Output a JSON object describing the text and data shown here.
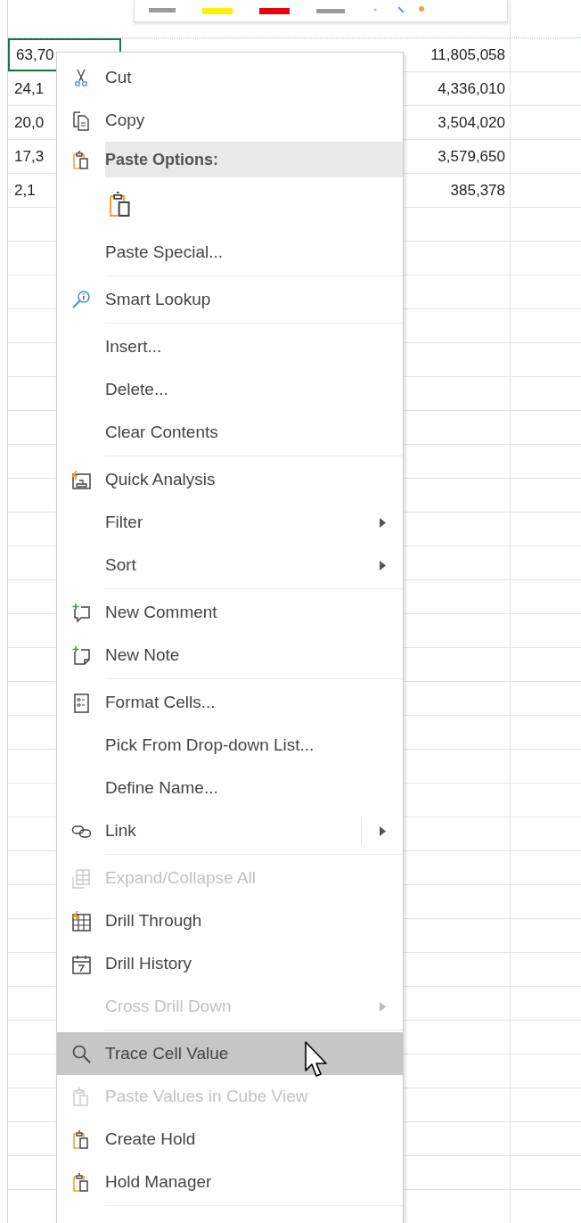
{
  "sheet": {
    "rows": [
      {
        "cells": [
          {
            "text": "63,70",
            "selected": true
          },
          {
            "text": "11,805,058",
            "selected": false
          }
        ]
      },
      {
        "cells": [
          {
            "text": "24,1",
            "selected": false
          },
          {
            "text": "4,336,010",
            "selected": false
          }
        ]
      },
      {
        "cells": [
          {
            "text": "20,0",
            "selected": false
          },
          {
            "text": "3,504,020",
            "selected": false
          }
        ]
      },
      {
        "cells": [
          {
            "text": "17,3",
            "selected": false
          },
          {
            "text": "3,579,650",
            "selected": false
          }
        ]
      },
      {
        "cells": [
          {
            "text": "2,1",
            "selected": false
          },
          {
            "text": "385,378",
            "selected": false
          }
        ]
      }
    ]
  },
  "context_menu": {
    "items": [
      {
        "kind": "command",
        "label": "Cut",
        "disabled": false,
        "selected": false,
        "submenu": false,
        "separator_after": false
      },
      {
        "kind": "command",
        "label": "Copy",
        "disabled": false,
        "selected": false,
        "submenu": false,
        "separator_after": false
      },
      {
        "kind": "header",
        "label": "Paste Options:"
      },
      {
        "kind": "paste-icons"
      },
      {
        "kind": "command",
        "label": "Paste Special...",
        "disabled": false,
        "selected": false,
        "submenu": false,
        "separator_after": true
      },
      {
        "kind": "command",
        "label": "Smart Lookup",
        "disabled": false,
        "selected": false,
        "submenu": false,
        "separator_after": true
      },
      {
        "kind": "command",
        "label": "Insert...",
        "disabled": false,
        "selected": false,
        "submenu": false,
        "separator_after": false
      },
      {
        "kind": "command",
        "label": "Delete...",
        "disabled": false,
        "selected": false,
        "submenu": false,
        "separator_after": false
      },
      {
        "kind": "command",
        "label": "Clear Contents",
        "disabled": false,
        "selected": false,
        "submenu": false,
        "separator_after": true
      },
      {
        "kind": "command",
        "label": "Quick Analysis",
        "disabled": false,
        "selected": false,
        "submenu": false,
        "separator_after": false
      },
      {
        "kind": "command",
        "label": "Filter",
        "disabled": false,
        "selected": false,
        "submenu": true,
        "separator_after": false
      },
      {
        "kind": "command",
        "label": "Sort",
        "disabled": false,
        "selected": false,
        "submenu": true,
        "separator_after": true
      },
      {
        "kind": "command",
        "label": "New Comment",
        "disabled": false,
        "selected": false,
        "submenu": false,
        "separator_after": false
      },
      {
        "kind": "command",
        "label": "New Note",
        "disabled": false,
        "selected": false,
        "submenu": false,
        "separator_after": true
      },
      {
        "kind": "command",
        "label": "Format Cells...",
        "disabled": false,
        "selected": false,
        "submenu": false,
        "separator_after": false
      },
      {
        "kind": "command",
        "label": "Pick From Drop-down List...",
        "disabled": false,
        "selected": false,
        "submenu": false,
        "separator_after": false
      },
      {
        "kind": "command",
        "label": "Define Name...",
        "disabled": false,
        "selected": false,
        "submenu": false,
        "separator_after": false
      },
      {
        "kind": "split",
        "label": "Link",
        "disabled": false,
        "selected": false,
        "submenu": true,
        "separator_after": true
      },
      {
        "kind": "command",
        "label": "Expand/Collapse All",
        "disabled": true,
        "selected": false,
        "submenu": false,
        "separator_after": false
      },
      {
        "kind": "command",
        "label": "Drill Through",
        "disabled": false,
        "selected": false,
        "submenu": false,
        "separator_after": false
      },
      {
        "kind": "command",
        "label": "Drill History",
        "disabled": false,
        "selected": false,
        "submenu": false,
        "separator_after": false
      },
      {
        "kind": "command",
        "label": "Cross Drill Down",
        "disabled": true,
        "selected": false,
        "submenu": true,
        "separator_after": true
      },
      {
        "kind": "command",
        "label": "Trace Cell Value",
        "disabled": false,
        "selected": true,
        "submenu": false,
        "separator_after": false
      },
      {
        "kind": "command",
        "label": "Paste Values in Cube View",
        "disabled": true,
        "selected": false,
        "submenu": false,
        "separator_after": false
      },
      {
        "kind": "command",
        "label": "Create Hold",
        "disabled": false,
        "selected": false,
        "submenu": false,
        "separator_after": false
      },
      {
        "kind": "command",
        "label": "Hold Manager",
        "disabled": false,
        "selected": false,
        "submenu": false,
        "separator_after": true
      }
    ]
  }
}
